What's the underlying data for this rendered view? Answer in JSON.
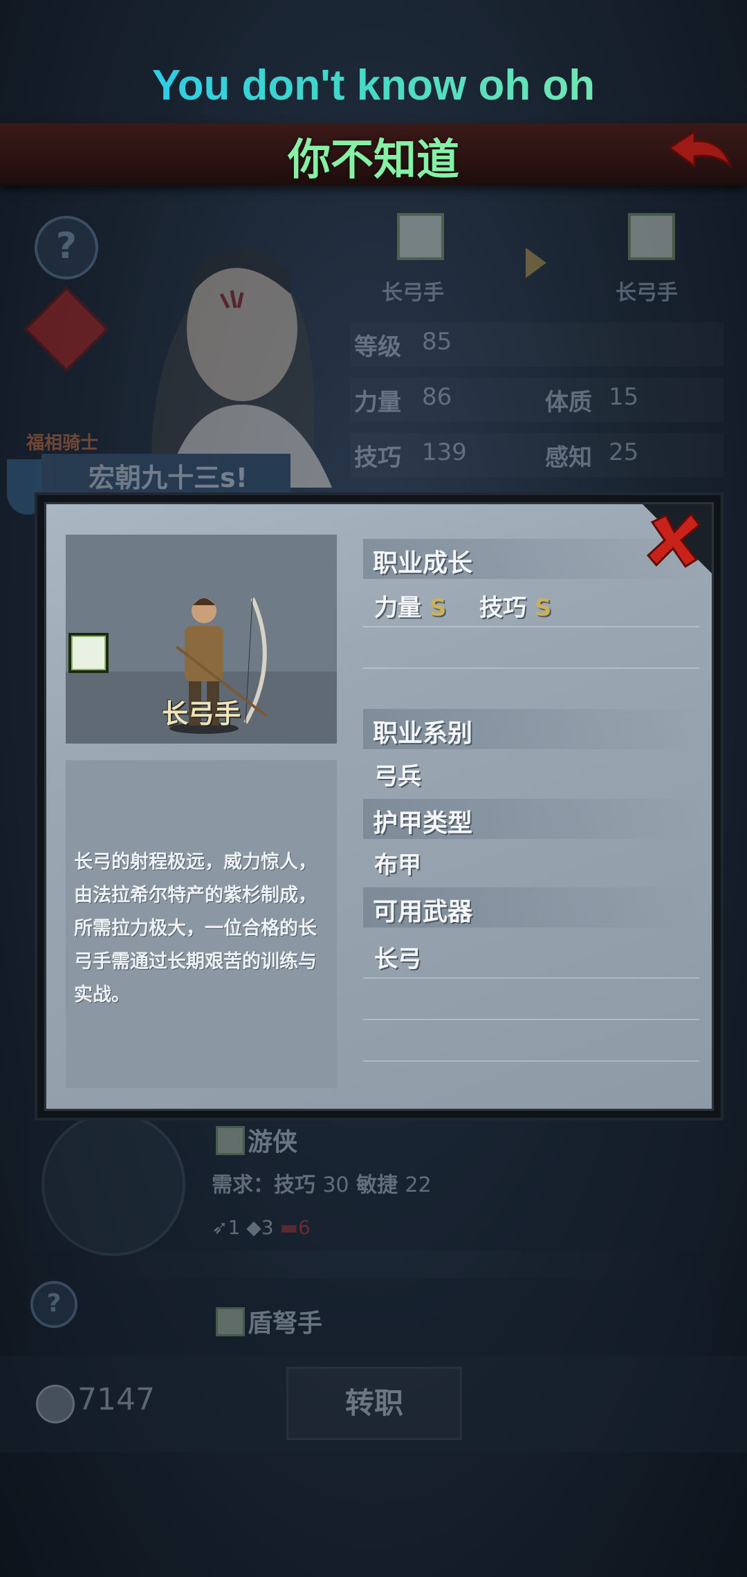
{
  "subtitle": {
    "en": "You don't know oh oh",
    "zh": "你不知道"
  },
  "bg": {
    "class_from": "长弓手",
    "class_to": "长弓手",
    "stats": [
      {
        "label": "等级",
        "value": "85"
      },
      {
        "label": "力量",
        "value": "86"
      },
      {
        "label": "体质",
        "value": "15"
      },
      {
        "label": "技巧",
        "value": "139"
      },
      {
        "label": "感知",
        "value": "25"
      }
    ],
    "title_tag": "福相骑士",
    "char_name": "宏朝九十三s!"
  },
  "modal": {
    "hero_class": "长弓手",
    "description": "长弓的射程极远，威力惊人，由法拉希尔特产的紫杉制成，所需拉力极大，一位合格的长弓手需通过长期艰苦的训练与实战。",
    "growth_title": "职业成长",
    "growth": [
      {
        "label": "力量",
        "grade": "S"
      },
      {
        "label": "技巧",
        "grade": "S"
      }
    ],
    "family_title": "职业系别",
    "family": "弓兵",
    "armor_title": "护甲类型",
    "armor": "布甲",
    "weapon_title": "可用武器",
    "weapon": "长弓"
  },
  "jobs": [
    {
      "name": "游侠",
      "req_label": "需求：",
      "req1": "技巧",
      "req1_val": "30",
      "req2": "敏捷",
      "req2_val": "22",
      "items": [
        "1",
        "3",
        "6"
      ]
    },
    {
      "name": "盾弩手"
    }
  ],
  "footer": {
    "coins": "7147",
    "transfer_label": "转职"
  }
}
